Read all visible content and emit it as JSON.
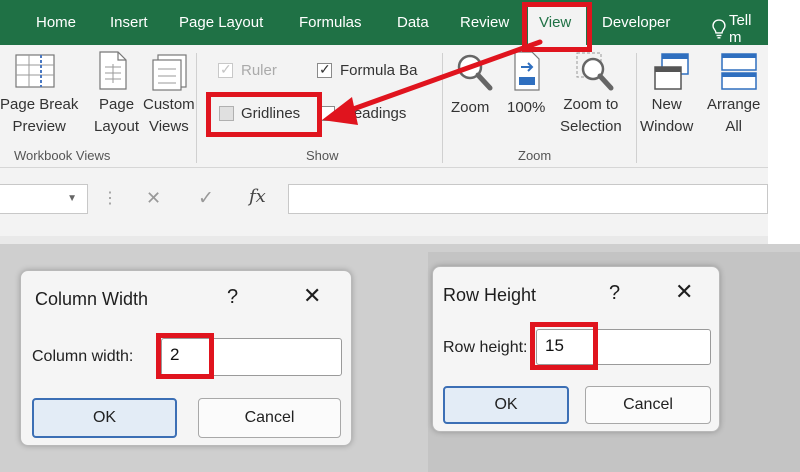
{
  "tabs": [
    "Home",
    "Insert",
    "Page Layout",
    "Formulas",
    "Data",
    "Review",
    "View",
    "Developer"
  ],
  "tell_me": "Tell m",
  "workbook_views": {
    "page_break": [
      "Page Break",
      "Preview"
    ],
    "page_layout": [
      "Page",
      "Layout"
    ],
    "custom_views": [
      "Custom",
      "Views"
    ],
    "group_label": "Workbook Views"
  },
  "show": {
    "ruler": "Ruler",
    "formula_bar": "Formula Ba",
    "gridlines": "Gridlines",
    "headings": "Headings",
    "group_label": "Show"
  },
  "zoom": {
    "zoom": "Zoom",
    "zoom_100": "100%",
    "zoom_to": [
      "Zoom to",
      "Selection"
    ],
    "group_label": "Zoom"
  },
  "window": {
    "new_window": [
      "New",
      "Window"
    ],
    "arrange_all": [
      "Arrange",
      "All"
    ]
  },
  "formula_bar": {
    "fx": "fx",
    "cancel_glyph": "✕",
    "enter_glyph": "✓"
  },
  "column_width_dialog": {
    "title": "Column Width",
    "help": "?",
    "label": "Column width:",
    "value": "2",
    "ok": "OK",
    "cancel": "Cancel"
  },
  "row_height_dialog": {
    "title": "Row Height",
    "help": "?",
    "label": "Row height:",
    "value": "15",
    "ok": "OK",
    "cancel": "Cancel"
  },
  "colors": {
    "ribbon_green": "#1f7145",
    "highlight_red": "#e0141e"
  }
}
